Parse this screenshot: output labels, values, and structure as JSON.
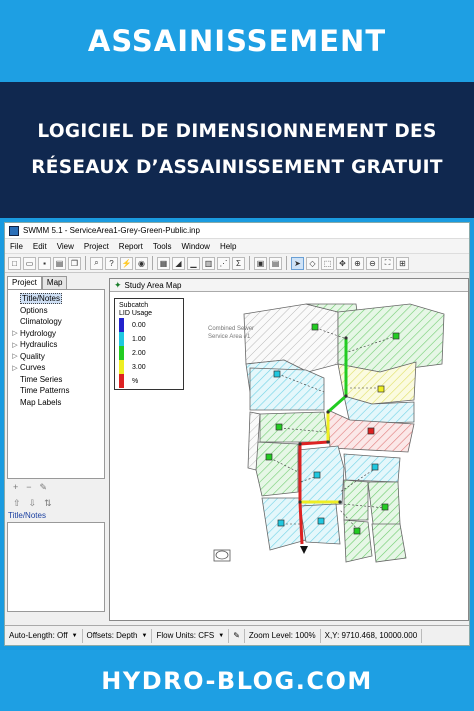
{
  "banner": {
    "title": "ASSAINISSEMENT"
  },
  "subtitle": {
    "line1": "LOGICIEL DE DIMENSIONNEMENT DES",
    "line2": "RÉSEAUX D’ASSAINISSEMENT GRATUIT"
  },
  "window": {
    "title": "SWMM 5.1 - ServiceArea1-Grey-Green-Public.inp"
  },
  "menu": [
    "File",
    "Edit",
    "View",
    "Project",
    "Report",
    "Tools",
    "Window",
    "Help"
  ],
  "left_panel": {
    "tabs": [
      "Project",
      "Map"
    ],
    "tree": [
      {
        "label": "Title/Notes",
        "expandable": false,
        "selected": true
      },
      {
        "label": "Options",
        "expandable": false
      },
      {
        "label": "Climatology",
        "expandable": false
      },
      {
        "label": "Hydrology",
        "expandable": true
      },
      {
        "label": "Hydraulics",
        "expandable": true
      },
      {
        "label": "Quality",
        "expandable": true
      },
      {
        "label": "Curves",
        "expandable": true
      },
      {
        "label": "Time Series",
        "expandable": false
      },
      {
        "label": "Time Patterns",
        "expandable": false
      },
      {
        "label": "Map Labels",
        "expandable": false
      }
    ],
    "notes_label": "Title/Notes"
  },
  "map": {
    "window_title": "Study Area Map",
    "annotation_line1": "Combined Sewer",
    "annotation_line2": "Service Area #1",
    "legend": {
      "title1": "Subcatch",
      "title2": "LID Usage",
      "items": [
        {
          "label": "0.00",
          "color": "#2222cc"
        },
        {
          "label": "1.00",
          "color": "#1fc8e0"
        },
        {
          "label": "2.00",
          "color": "#22cc22"
        },
        {
          "label": "3.00",
          "color": "#eeee22"
        },
        {
          "label": "%",
          "color": "#dd2222"
        }
      ]
    }
  },
  "statusbar": {
    "auto_length": "Auto-Length: Off",
    "offsets": "Offsets: Depth",
    "flow_units": "Flow Units: CFS",
    "zoom": "Zoom Level: 100%",
    "xy": "X,Y: 9710.468, 10000.000"
  },
  "footer": {
    "site": "HYDRO-BLOG.COM"
  },
  "colors": {
    "banner": "#1e9fe3",
    "subtitle_bg": "#10284f"
  }
}
